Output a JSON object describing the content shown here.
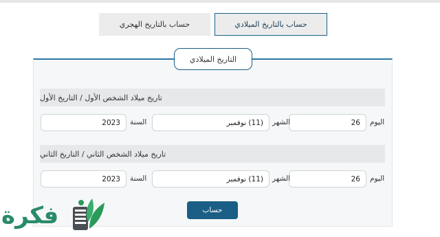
{
  "tabs": {
    "hijri": "حساب بالتاريخ الهجري",
    "gregorian": "حساب بالتاريخ الميلادي"
  },
  "panel": {
    "legend": "التاريخ الميلادي"
  },
  "first_date": {
    "title": "تاريخ ميلاد الشخص الأول / التاريخ الأول",
    "day_label": "اليوم",
    "day_value": "26",
    "month_label": "الشهر",
    "month_value": "(11) نوفمبر",
    "year_label": "السنة",
    "year_value": "2023"
  },
  "second_date": {
    "title": "تاريخ ميلاد الشخص الثاني / التاريخ الثاني",
    "day_label": "اليوم",
    "day_value": "26",
    "month_label": "الشهر",
    "month_value": "(11) نوفمبر",
    "year_label": "السنة",
    "year_value": "2023"
  },
  "calculate_button": "حساب",
  "logo": {
    "text": "فكرة",
    "icon": "book-leaf-icon"
  },
  "colors": {
    "accent": "#1a5e85",
    "panel_top_border": "#2a78a5",
    "logo_green": "#2a8a6a"
  }
}
